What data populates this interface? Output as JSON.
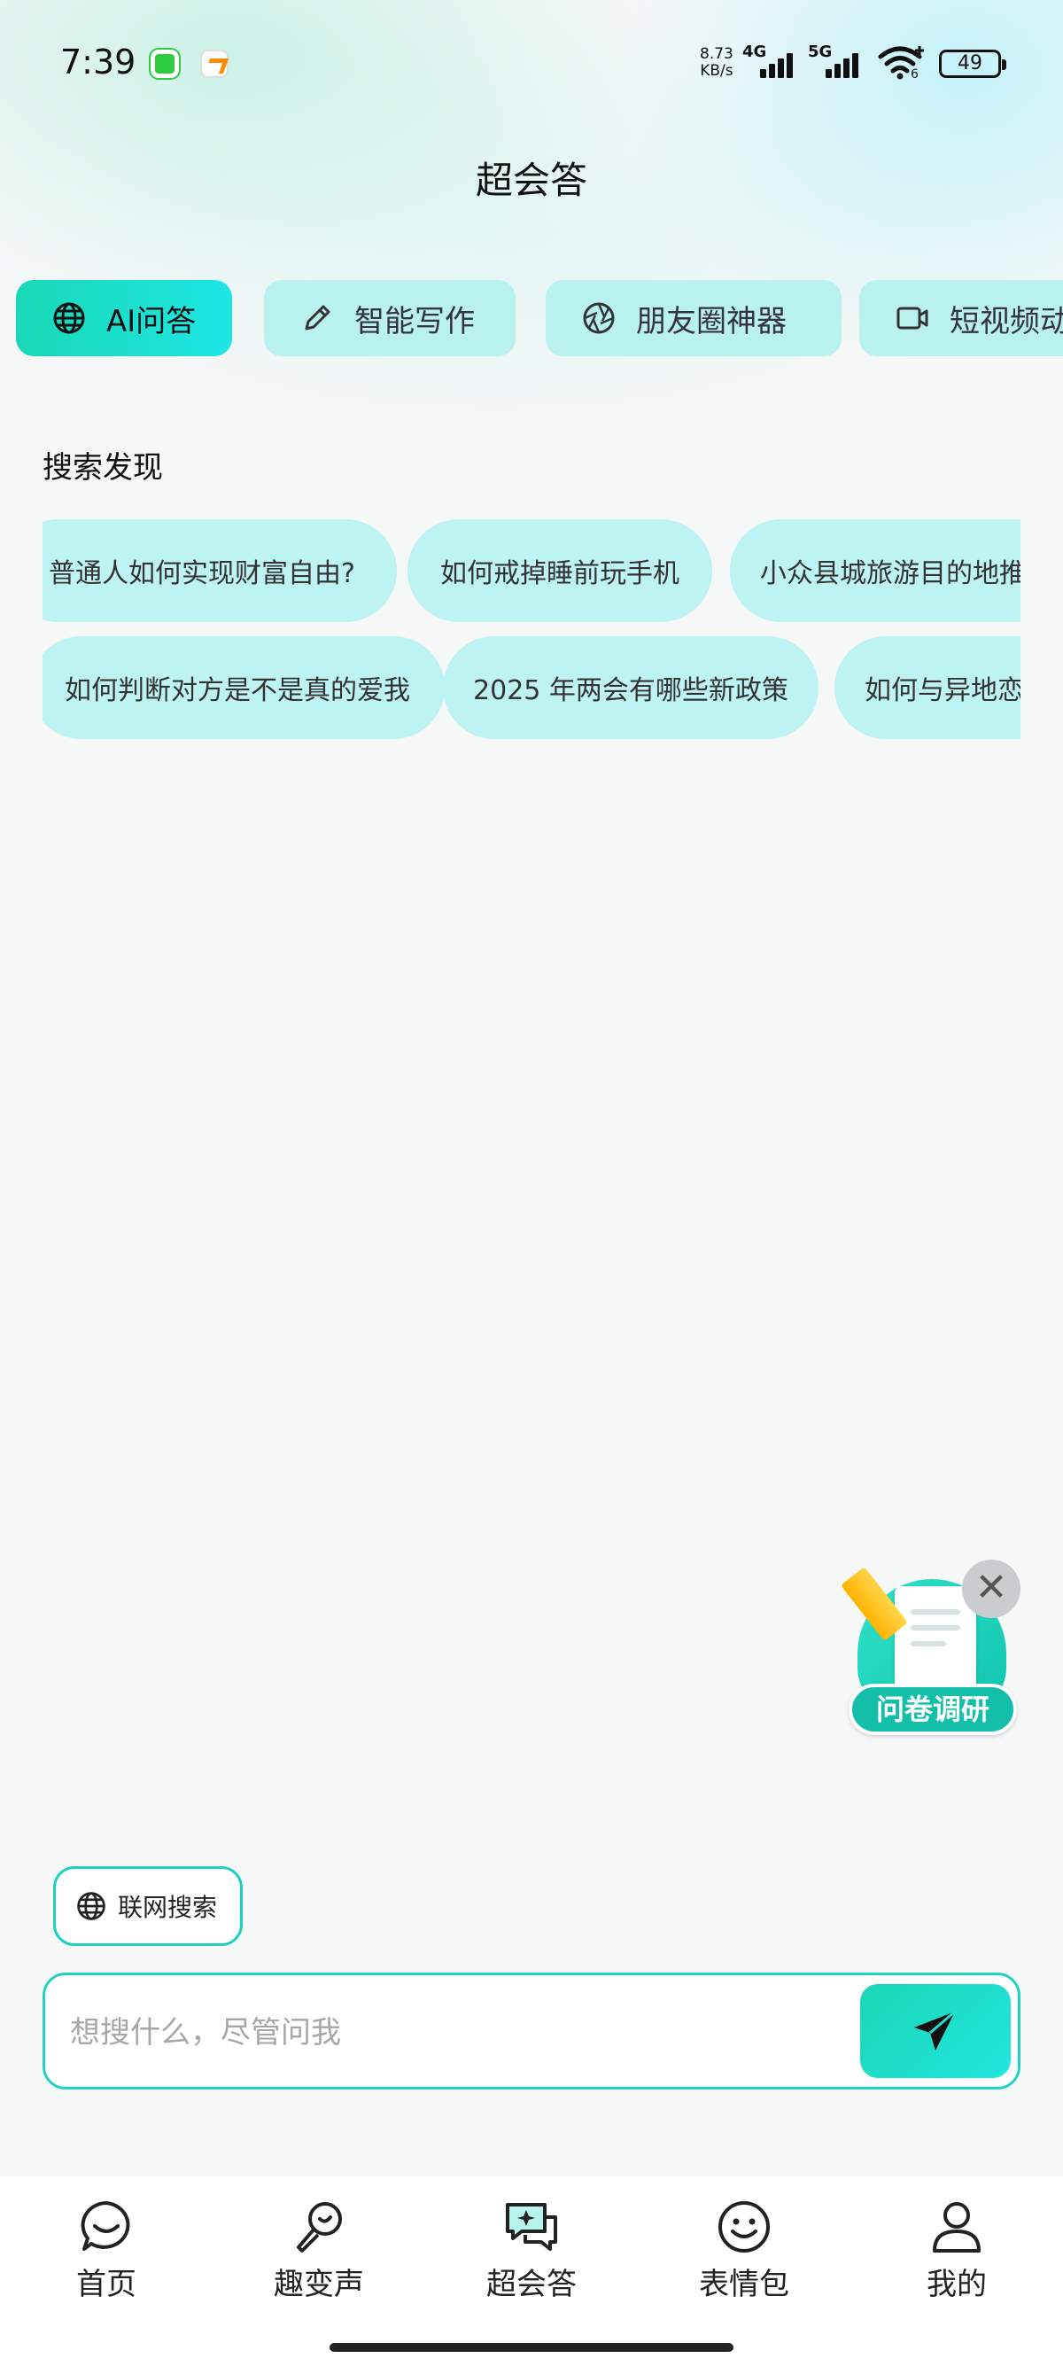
{
  "status_bar": {
    "time": "7:39",
    "net_speed_value": "8.73",
    "net_speed_unit": "KB/s",
    "signal_1_label": "4G",
    "signal_2_label": "5G",
    "wifi_sub": "6",
    "battery": "49"
  },
  "header": {
    "title": "超会答"
  },
  "tabs": [
    {
      "label": "AI问答",
      "icon": "globe-icon",
      "active": true
    },
    {
      "label": "智能写作",
      "icon": "pencil-icon",
      "active": false
    },
    {
      "label": "朋友圈神器",
      "icon": "aperture-icon",
      "active": false
    },
    {
      "label": "短视频动",
      "icon": "video-icon",
      "active": false
    }
  ],
  "discover": {
    "title": "搜索发现",
    "row1": [
      "普通人如何实现财富自由?",
      "如何戒掉睡前玩手机",
      "小众县城旅游目的地推"
    ],
    "row2": [
      "如何判断对方是不是真的爱我",
      "2025 年两会有哪些新政策",
      "如何与异地恋"
    ]
  },
  "survey": {
    "label": "问卷调研",
    "close": "✕"
  },
  "web_search": {
    "label": "联网搜索"
  },
  "input": {
    "placeholder": "想搜什么，尽管问我",
    "value": ""
  },
  "bottom_nav": [
    {
      "label": "首页",
      "icon": "smile-chat-icon"
    },
    {
      "label": "趣变声",
      "icon": "microphone-icon"
    },
    {
      "label": "超会答",
      "icon": "sparkle-chat-icon"
    },
    {
      "label": "表情包",
      "icon": "emoji-icon"
    },
    {
      "label": "我的",
      "icon": "user-icon"
    }
  ],
  "colors": {
    "accent": "#1fd3c0",
    "chip_bg": "#bdf3f2",
    "tab_bg": "#b9f1ee"
  }
}
